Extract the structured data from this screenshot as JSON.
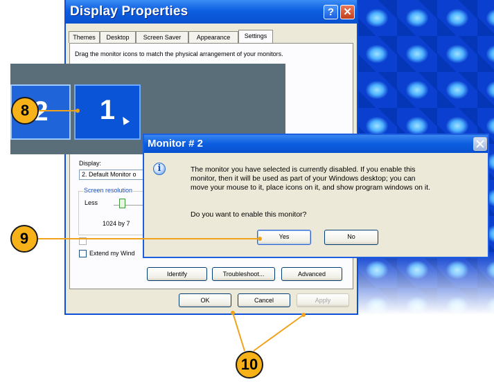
{
  "display_properties": {
    "title": "Display Properties",
    "help_glyph": "?",
    "close_glyph": "✕",
    "tabs": [
      {
        "label": "Themes",
        "active": false
      },
      {
        "label": "Desktop",
        "active": false
      },
      {
        "label": "Screen Saver",
        "active": false
      },
      {
        "label": "Appearance",
        "active": false
      },
      {
        "label": "Settings",
        "active": true
      }
    ],
    "instruction": "Drag the monitor icons to match the physical arrangement of your monitors.",
    "monitors": {
      "left": "2",
      "right": "1"
    },
    "display_label": "Display:",
    "display_value": "2. Default Monitor o",
    "screen_resolution_label": "Screen resolution",
    "less_label": "Less",
    "resolution_value": "1024 by 7",
    "extend_label": "Extend my Wind",
    "buttons": {
      "identify": "Identify",
      "troubleshoot": "Troubleshoot...",
      "advanced": "Advanced",
      "ok": "OK",
      "cancel": "Cancel",
      "apply": "Apply"
    }
  },
  "monitor_dialog": {
    "title": "Monitor # 2",
    "icon": "info-icon",
    "message_lines": [
      "The monitor you have selected is currently disabled. If you enable this",
      "monitor, then it will be used as part of your Windows desktop; you can",
      "move your mouse to it, place icons on it, and show program windows on it."
    ],
    "question": "Do you want to enable this monitor?",
    "yes_label": "Yes",
    "no_label": "No"
  },
  "callouts": {
    "step8": "8",
    "step9": "9",
    "step10": "10"
  },
  "colors": {
    "callout_fill": "#f7b21a",
    "xp_blue": "#0b5ddf"
  }
}
